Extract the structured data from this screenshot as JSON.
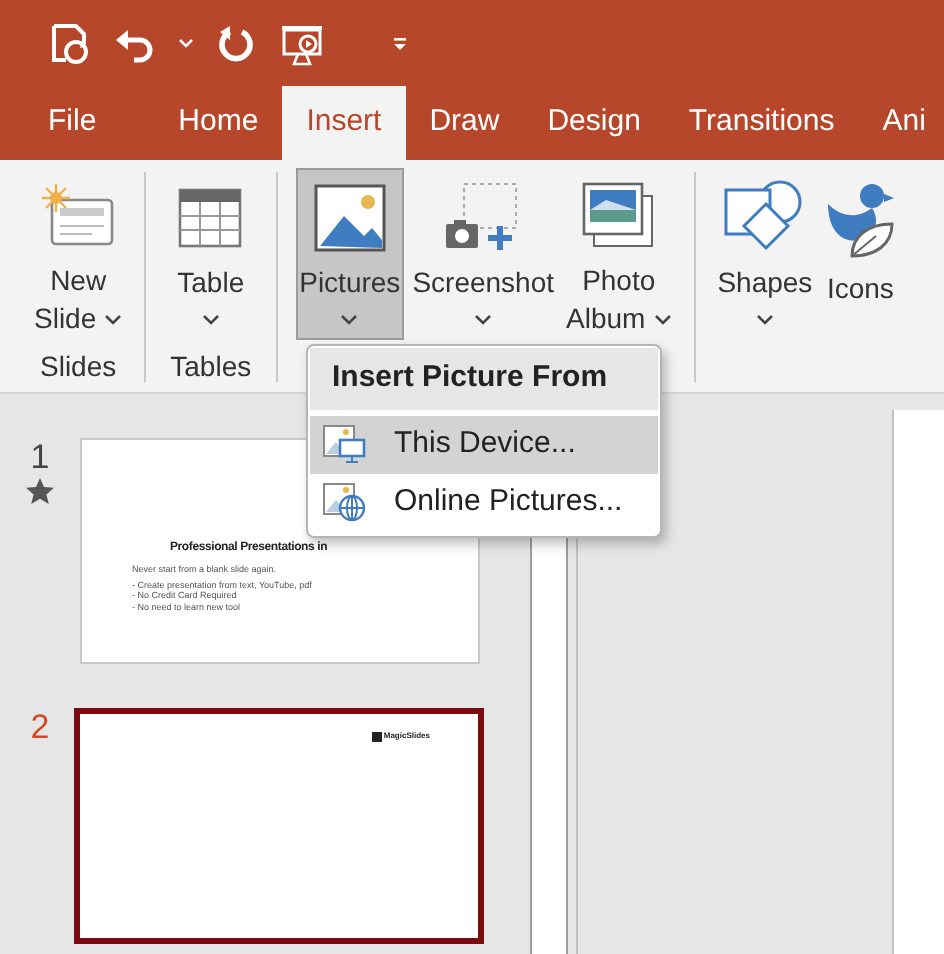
{
  "tabs": [
    {
      "label": "File",
      "selected": false
    },
    {
      "label": "Home",
      "selected": false
    },
    {
      "label": "Insert",
      "selected": true
    },
    {
      "label": "Draw",
      "selected": false
    },
    {
      "label": "Design",
      "selected": false
    },
    {
      "label": "Transitions",
      "selected": false
    },
    {
      "label": "Ani",
      "selected": false
    }
  ],
  "ribbon": {
    "groups": [
      {
        "label": "Slides",
        "buttons": [
          {
            "kind": "new-slide",
            "lines": [
              "New",
              "Slide"
            ],
            "dropdown": true,
            "selected": false
          }
        ]
      },
      {
        "label": "Tables",
        "buttons": [
          {
            "kind": "table",
            "lines": [
              "Table"
            ],
            "dropdown": true,
            "selected": false
          }
        ]
      },
      {
        "buttons": [
          {
            "kind": "pictures",
            "lines": [
              "Pictures"
            ],
            "dropdown": true,
            "selected": true
          },
          {
            "kind": "screenshot",
            "lines": [
              "Screenshot"
            ],
            "dropdown": true,
            "selected": false
          },
          {
            "kind": "photo-album",
            "lines": [
              "Photo",
              "Album"
            ],
            "dropdown": true,
            "selected": false
          }
        ]
      },
      {
        "buttons": [
          {
            "kind": "shapes",
            "lines": [
              "Shapes"
            ],
            "dropdown": true,
            "selected": false
          },
          {
            "kind": "icons",
            "lines": [
              "Icons"
            ],
            "dropdown": false,
            "selected": false
          }
        ]
      }
    ]
  },
  "menu": {
    "header": "Insert Picture From",
    "items": [
      {
        "kind": "device",
        "label": "This Device...",
        "selected": true
      },
      {
        "kind": "online",
        "label": "Online Pictures...",
        "selected": false
      }
    ]
  },
  "slides": [
    {
      "number": "1",
      "animated": true,
      "selected": false,
      "title": "Professional Presentations in",
      "intro": "Never start from a blank slide again.",
      "bullets": [
        "- Create presentation from text, YouTube, pdf",
        "- No Credit Card Required",
        "- No need to learn new tool"
      ]
    },
    {
      "number": "2",
      "animated": false,
      "selected": true,
      "logo": "MagicSlides"
    }
  ]
}
